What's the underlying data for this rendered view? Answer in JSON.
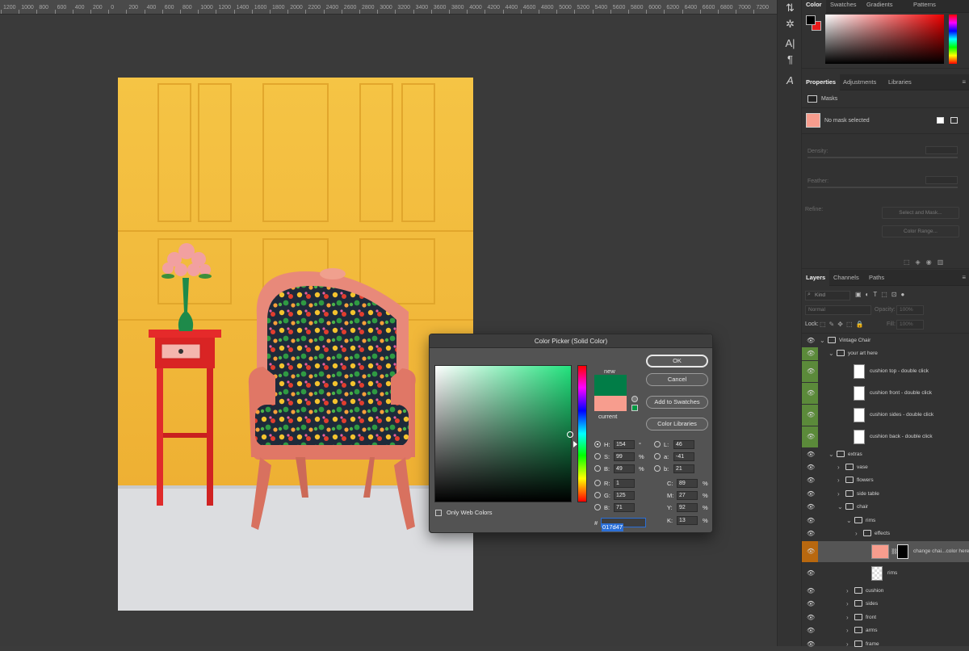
{
  "ruler": {
    "labels": [
      "1200",
      "1000",
      "800",
      "600",
      "400",
      "200",
      "0",
      "200",
      "400",
      "600",
      "800",
      "1000",
      "1200",
      "1400",
      "1600",
      "1800",
      "2000",
      "2200",
      "2400",
      "2600",
      "2800",
      "3000",
      "3200",
      "3400",
      "3600",
      "3800",
      "4000",
      "4200",
      "4400",
      "4600",
      "4800",
      "5000",
      "5200",
      "5400",
      "5600",
      "5800",
      "6000",
      "6200",
      "6400",
      "6600",
      "6800",
      "7000",
      "7200"
    ]
  },
  "panels": {
    "color_tabs": [
      "Color",
      "Swatches",
      "Gradients",
      "Patterns"
    ],
    "properties_tabs": [
      "Properties",
      "Adjustments",
      "Libraries"
    ],
    "properties": {
      "section": "Masks",
      "mask_status": "No mask selected",
      "density_label": "Density:",
      "feather_label": "Feather:",
      "refine_label": "Refine:",
      "select_mask_button": "Select and Mask...",
      "color_range_button": "Color Range..."
    },
    "layers_tabs": [
      "Layers",
      "Channels",
      "Paths"
    ],
    "layers_filter": "Kind",
    "blend_mode": "Normal",
    "opacity_label": "Opacity:",
    "opacity_value": "100%",
    "lock_label": "Lock:",
    "fill_label": "Fill:",
    "fill_value": "100%",
    "layers": [
      {
        "name": "Vintage Chair",
        "kind": "group",
        "indent": 0,
        "open": true
      },
      {
        "name": "your art here",
        "kind": "group",
        "indent": 1,
        "open": true
      },
      {
        "name": "cushion top - double click",
        "kind": "smart",
        "indent": 2
      },
      {
        "name": "cushion front - double click",
        "kind": "smart",
        "indent": 2
      },
      {
        "name": "cushion sides - double click",
        "kind": "smart",
        "indent": 2
      },
      {
        "name": "cushion back - double click",
        "kind": "smart",
        "indent": 2
      },
      {
        "name": "extras",
        "kind": "group",
        "indent": 1,
        "open": true
      },
      {
        "name": "vase",
        "kind": "group",
        "indent": 2,
        "open": false
      },
      {
        "name": "flowers",
        "kind": "group",
        "indent": 2,
        "open": false
      },
      {
        "name": "side table",
        "kind": "group",
        "indent": 2,
        "open": false
      },
      {
        "name": "chair",
        "kind": "group",
        "indent": 2,
        "open": true
      },
      {
        "name": "rims",
        "kind": "group",
        "indent": 3,
        "open": true
      },
      {
        "name": "effects",
        "kind": "group",
        "indent": 4,
        "open": false
      },
      {
        "name": "change chai...color here",
        "kind": "fill",
        "indent": 4,
        "selected": true
      },
      {
        "name": "rims",
        "kind": "pixel",
        "indent": 4
      },
      {
        "name": "cushion",
        "kind": "group",
        "indent": 3,
        "open": false
      },
      {
        "name": "sides",
        "kind": "group",
        "indent": 3,
        "open": false
      },
      {
        "name": "front",
        "kind": "group",
        "indent": 3,
        "open": false
      },
      {
        "name": "arms",
        "kind": "group",
        "indent": 3,
        "open": false
      },
      {
        "name": "frame",
        "kind": "group",
        "indent": 3,
        "open": false
      }
    ]
  },
  "picker": {
    "title": "Color Picker (Solid Color)",
    "new_label": "new",
    "current_label": "current",
    "new_color": "#017d47",
    "current_color": "#f79d8e",
    "ok": "OK",
    "cancel": "Cancel",
    "add_to_swatches": "Add to Swatches",
    "color_libraries": "Color Libraries",
    "only_web_colors": "Only Web Colors",
    "hsb": [
      {
        "key": "H:",
        "value": "154",
        "unit": "°",
        "selected": true
      },
      {
        "key": "S:",
        "value": "99",
        "unit": "%"
      },
      {
        "key": "B:",
        "value": "49",
        "unit": "%"
      }
    ],
    "rgb": [
      {
        "key": "R:",
        "value": "1"
      },
      {
        "key": "G:",
        "value": "125"
      },
      {
        "key": "B:",
        "value": "71"
      }
    ],
    "lab": [
      {
        "key": "L:",
        "value": "46"
      },
      {
        "key": "a:",
        "value": "-41"
      },
      {
        "key": "b:",
        "value": "21"
      }
    ],
    "cmyk": [
      {
        "key": "C:",
        "value": "89",
        "unit": "%"
      },
      {
        "key": "M:",
        "value": "27",
        "unit": "%"
      },
      {
        "key": "Y:",
        "value": "92",
        "unit": "%"
      },
      {
        "key": "K:",
        "value": "13",
        "unit": "%"
      }
    ],
    "hash": "#",
    "hex": "017d47"
  },
  "colors": {
    "foreground": "#000000",
    "background": "#e81c1c",
    "selection_blue": "#2b6fd6",
    "layer_highlight": "#4a4a4a",
    "smart_eye_bg": "#5b8a3a",
    "fill_eye_bg": "#b8680f"
  }
}
